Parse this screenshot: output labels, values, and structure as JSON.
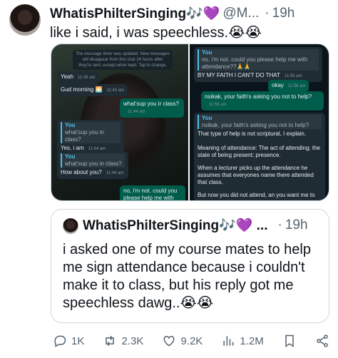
{
  "tweet": {
    "author_name": "WhatisPhilterSinging🎶💜",
    "handle": "@M...",
    "separator": "·",
    "time": "19h",
    "more_icon": "···",
    "text": "like i said, i was speechless.😭😭"
  },
  "media": {
    "left": {
      "system_notice": "The message timer was updated. New messages will disappear from this chat 24 hours after they're sent, except when kept. Tap to change.",
      "messages": [
        {
          "text": "Yeah",
          "time": "11:43 am"
        },
        {
          "text": "Gud morning 🌅",
          "time": "11:43 am"
        },
        {
          "text": "what'sup you ir class?",
          "time": "11:44 am"
        },
        {
          "quote_author": "You",
          "quote_text": "what'sup you in class?",
          "text": "Yes, i am",
          "time": "11:44 am"
        },
        {
          "quote_author": "You",
          "quote_text": "what'sup you in class?",
          "text": "How about you?",
          "time": "11:44 am"
        },
        {
          "text": "no, i'm not. could you please help me with attendance??"
        }
      ]
    },
    "right": {
      "messages": [
        {
          "quote_author": "You",
          "quote_text": "no, i'm not. could you please help me with attendance??🙏🙏",
          "text": "BY MY FAITH I CAN'T DO THAT",
          "time": "11:55 am"
        },
        {
          "text": "okay",
          "time": "11:56 am"
        },
        {
          "text": "nsikak, your faith's asking you not to help?",
          "time": "11:56 am"
        },
        {
          "quote_author": "You",
          "quote_text": "nsikak, your faith's asking you not to help?",
          "text": "That type of help is not scriptural, I explain."
        },
        {
          "text": "Meaning of attendance: The act of attending; the state of being present; presence."
        },
        {
          "text": "When a lecturer picks up the attendance he assumes that everyones name there attended that class."
        },
        {
          "text": "But now you did not attend, an you want me to"
        }
      ]
    }
  },
  "quoted": {
    "author_name": "WhatisPhilterSinging🎶💜 ...",
    "separator": "·",
    "time": "19h",
    "text": "i asked one of my course mates to help me sign attendance because i couldn't make it to class, but his reply got me speechless dawg..😭😭"
  },
  "actions": {
    "replies": "1K",
    "retweets": "2.3K",
    "likes": "9.2K",
    "views": "1.2M"
  }
}
